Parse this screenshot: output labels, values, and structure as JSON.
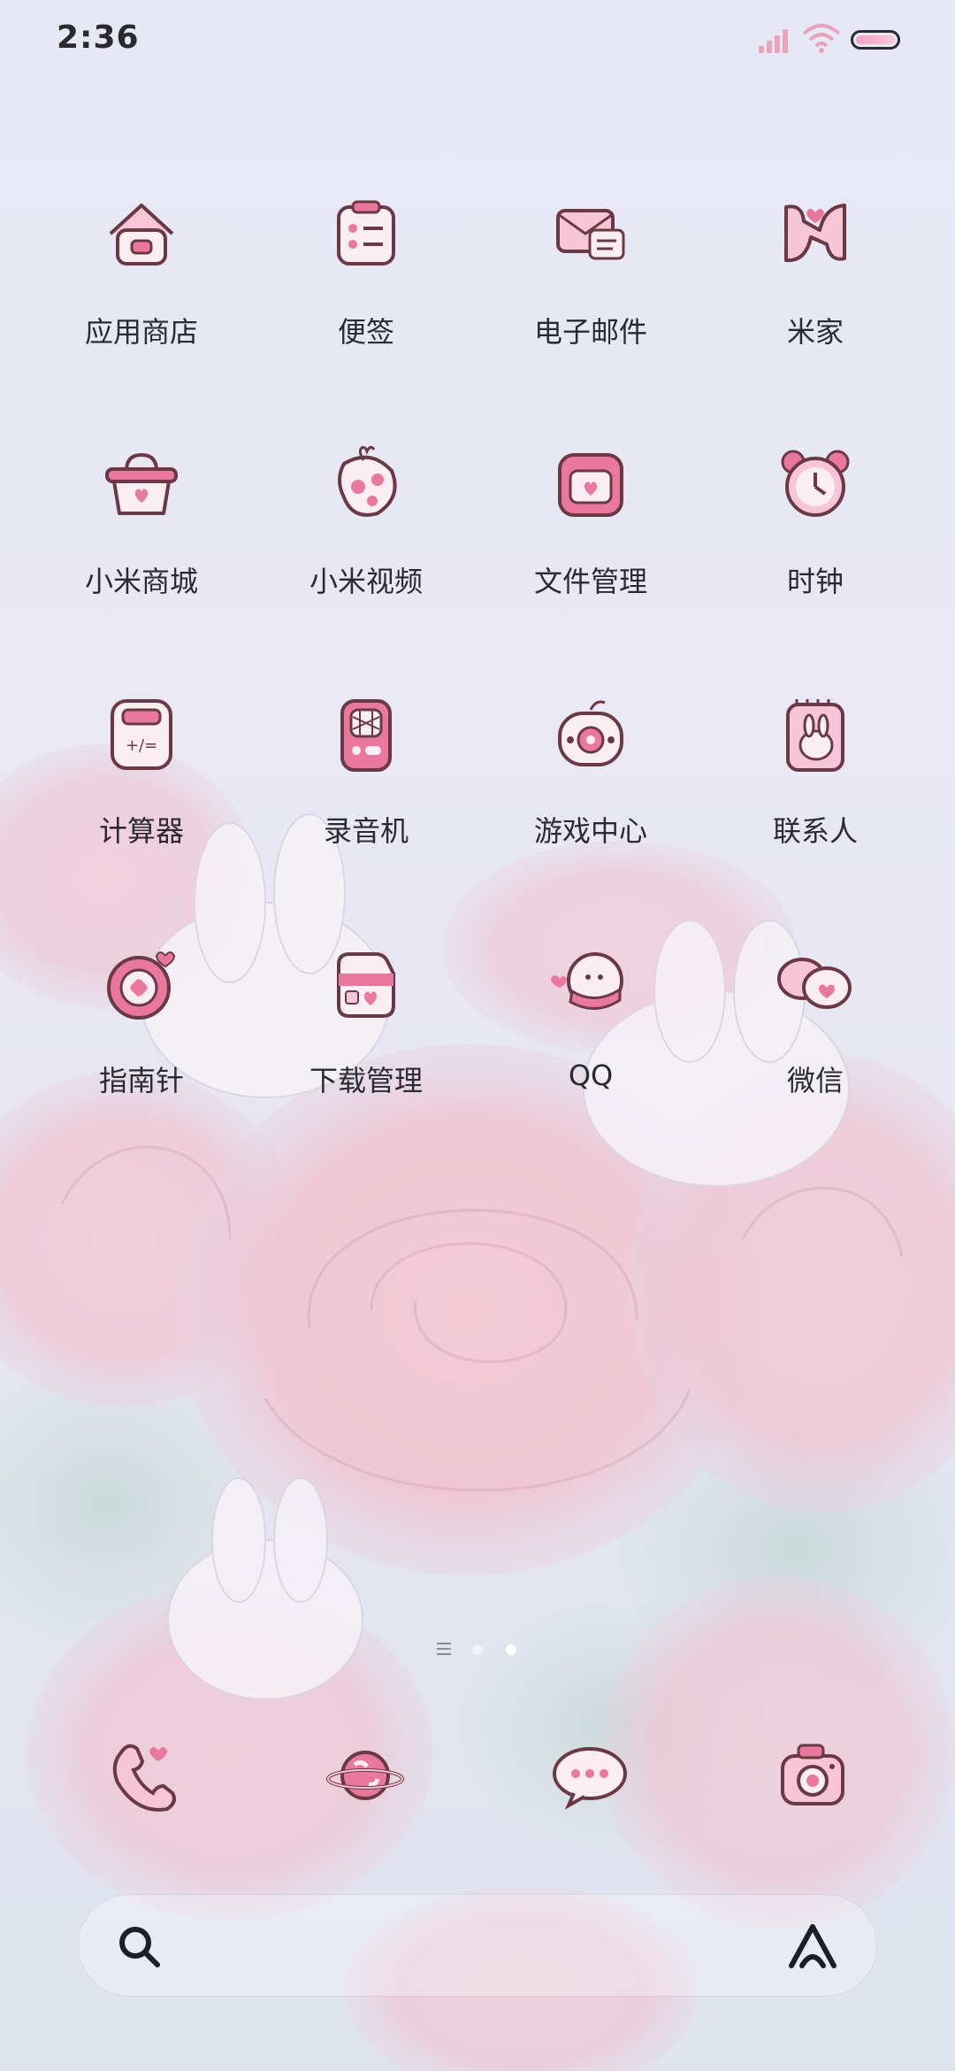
{
  "status_bar": {
    "time": "2:36"
  },
  "apps": [
    {
      "label": "应用商店",
      "icon": "store-house-icon"
    },
    {
      "label": "便签",
      "icon": "notes-icon"
    },
    {
      "label": "电子邮件",
      "icon": "email-icon"
    },
    {
      "label": "米家",
      "icon": "mijia-icon"
    },
    {
      "label": "小米商城",
      "icon": "shopping-basket-icon"
    },
    {
      "label": "小米视频",
      "icon": "video-icon"
    },
    {
      "label": "文件管理",
      "icon": "folder-icon"
    },
    {
      "label": "时钟",
      "icon": "alarm-clock-icon"
    },
    {
      "label": "计算器",
      "icon": "calculator-icon"
    },
    {
      "label": "录音机",
      "icon": "recorder-icon"
    },
    {
      "label": "游戏中心",
      "icon": "game-controller-icon"
    },
    {
      "label": "联系人",
      "icon": "contacts-icon"
    },
    {
      "label": "指南针",
      "icon": "compass-icon"
    },
    {
      "label": "下载管理",
      "icon": "download-icon"
    },
    {
      "label": "QQ",
      "icon": "qq-icon"
    },
    {
      "label": "微信",
      "icon": "wechat-icon"
    }
  ],
  "page_indicator": {
    "pages": 3,
    "active": 3
  },
  "dock": [
    {
      "icon": "phone-icon"
    },
    {
      "icon": "browser-planet-icon"
    },
    {
      "icon": "messages-icon"
    },
    {
      "icon": "camera-icon"
    }
  ],
  "search_bar": {
    "left_icon": "search-icon",
    "right_icon": "assistant-icon"
  },
  "colors": {
    "accent": "#e9779e",
    "icon_fill": "#f6c6d6",
    "icon_stroke": "#6a3a44"
  }
}
